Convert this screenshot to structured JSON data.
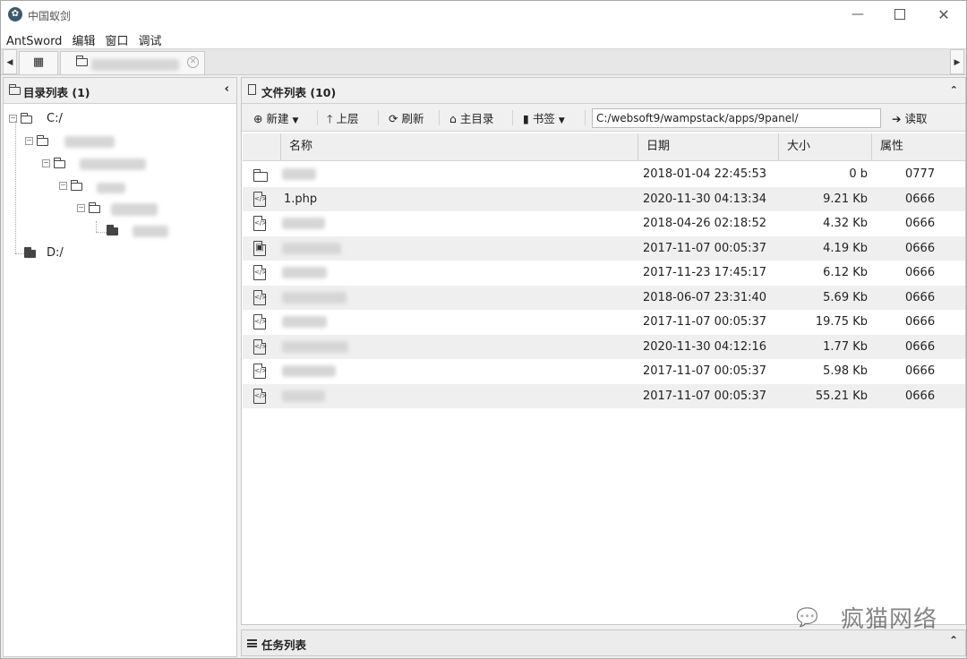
{
  "window": {
    "title": "中国蚁剑",
    "minimize": "—",
    "close": "✕"
  },
  "menu": [
    "AntSword",
    "编辑",
    "窗口",
    "调试"
  ],
  "left_panel": {
    "title": "目录列表 (1)",
    "drives": [
      {
        "label": "C:/"
      },
      {
        "label": "D:/"
      }
    ]
  },
  "right_panel": {
    "title": "文件列表 (10)",
    "toolbar": {
      "new": "新建",
      "up": "上层",
      "refresh": "刷新",
      "home": "主目录",
      "bookmark": "书签",
      "path": "C:/websoft9/wampstack/apps/9panel/",
      "read": "读取"
    },
    "columns": [
      "名称",
      "日期",
      "大小",
      "属性"
    ],
    "files": [
      {
        "type": "folder",
        "name": "",
        "date": "2018-01-04 22:45:53",
        "size": "0 b",
        "attr": "0777"
      },
      {
        "type": "code",
        "name": "1.php",
        "date": "2020-11-30 04:13:34",
        "size": "9.21 Kb",
        "attr": "0666"
      },
      {
        "type": "code",
        "name": "",
        "date": "2018-04-26 02:18:52",
        "size": "4.32 Kb",
        "attr": "0666"
      },
      {
        "type": "image",
        "name": "",
        "date": "2017-11-07 00:05:37",
        "size": "4.19 Kb",
        "attr": "0666"
      },
      {
        "type": "code",
        "name": "",
        "date": "2017-11-23 17:45:17",
        "size": "6.12 Kb",
        "attr": "0666"
      },
      {
        "type": "code",
        "name": "",
        "date": "2018-06-07 23:31:40",
        "size": "5.69 Kb",
        "attr": "0666"
      },
      {
        "type": "code",
        "name": "",
        "date": "2017-11-07 00:05:37",
        "size": "19.75 Kb",
        "attr": "0666"
      },
      {
        "type": "code",
        "name": "",
        "date": "2020-11-30 04:12:16",
        "size": "1.77 Kb",
        "attr": "0666"
      },
      {
        "type": "code",
        "name": "",
        "date": "2017-11-07 00:05:37",
        "size": "5.98 Kb",
        "attr": "0666"
      },
      {
        "type": "code",
        "name": "",
        "date": "2017-11-07 00:05:37",
        "size": "55.21 Kb",
        "attr": "0666"
      }
    ]
  },
  "task_panel": {
    "title": "任务列表"
  },
  "watermark": {
    "text": "疯猫网络"
  }
}
